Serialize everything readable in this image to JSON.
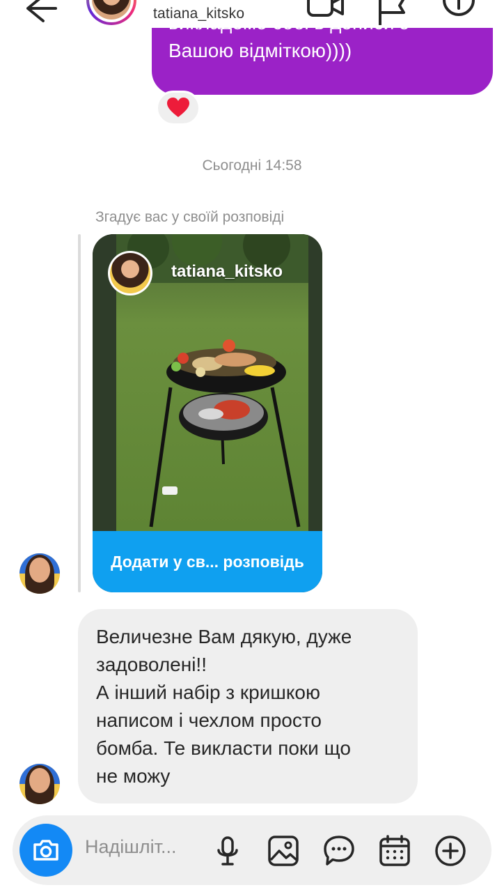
{
  "header": {
    "username": "tatiana_kitsko"
  },
  "messages": {
    "outgoing_line1": "викладемо собі в дописи з",
    "outgoing_line2": "Вашою відміткою))))",
    "reaction": "❤️",
    "timestamp": "Сьогодні 14:58",
    "mention_label": "Згадує вас у своїй розповіді",
    "story": {
      "username": "tatiana_kitsko",
      "cta_label": "Додати у св... розповідь"
    },
    "incoming_text": "Величезне Вам дякую, дуже\nзадоволені!!\nА інший набір з кришкою\nнаписом і чехлом просто\nбомба. Те викласти поки що\nне можу"
  },
  "composer": {
    "placeholder": "Надішліт..."
  },
  "colors": {
    "outgoing_bubble": "#9b22c7",
    "incoming_bubble": "#efefef",
    "accent_blue": "#1389f5",
    "story_cta": "#0fa0f0"
  },
  "icons": [
    "back-arrow-icon",
    "video-call-icon",
    "flag-icon",
    "info-icon",
    "heart-icon",
    "camera-icon",
    "microphone-icon",
    "gallery-icon",
    "sticker-icon",
    "calendar-icon",
    "plus-icon"
  ]
}
